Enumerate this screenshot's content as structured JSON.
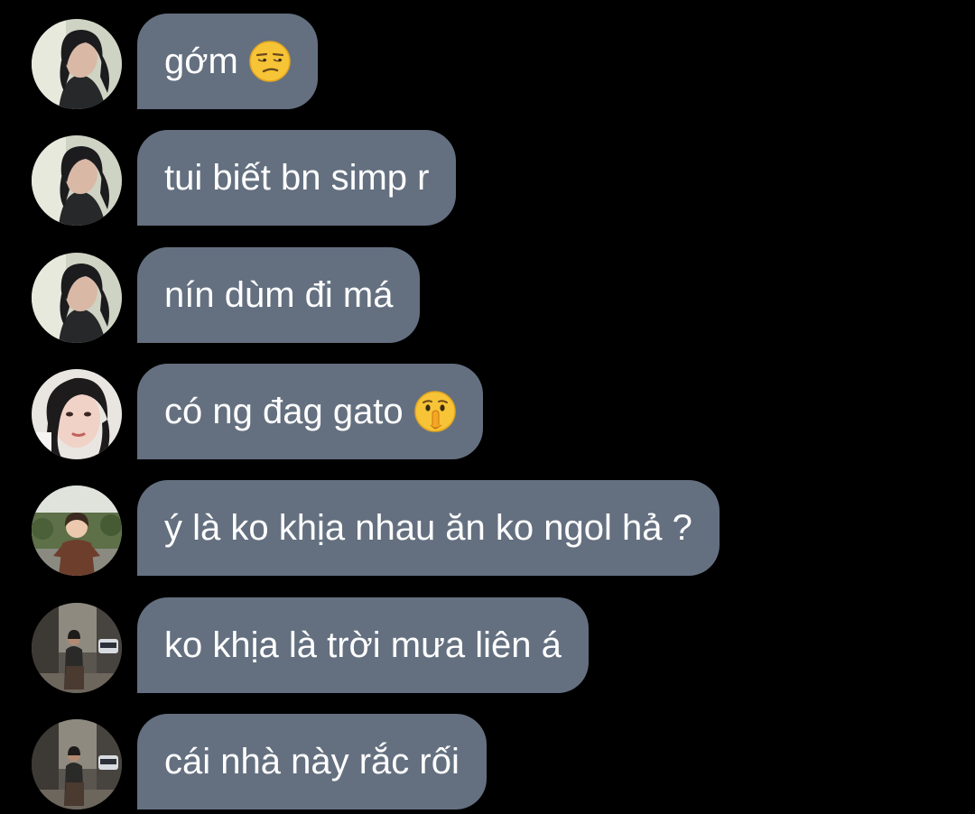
{
  "chat": {
    "messages": [
      {
        "text": "gớm",
        "emoji": "unamused-face-icon",
        "avatar": "avatar-girl-dark-hair"
      },
      {
        "text": "tui biết bn simp r",
        "emoji": null,
        "avatar": "avatar-girl-dark-hair"
      },
      {
        "text": "nín dùm đi má",
        "emoji": null,
        "avatar": "avatar-girl-dark-hair"
      },
      {
        "text": "có ng đag gato",
        "emoji": "shushing-face-icon",
        "avatar": "avatar-girl-closeup"
      },
      {
        "text": "ý là ko khịa nhau ăn ko ngol hả ?",
        "emoji": null,
        "avatar": "avatar-child-outdoor"
      },
      {
        "text": "ko khịa là trời mưa liên á",
        "emoji": null,
        "avatar": "avatar-street-photo"
      },
      {
        "text": "cái nhà này rắc rối",
        "emoji": null,
        "avatar": "avatar-street-photo"
      }
    ]
  },
  "colors": {
    "background": "#000000",
    "bubble": "#647080",
    "text": "#ffffff"
  }
}
